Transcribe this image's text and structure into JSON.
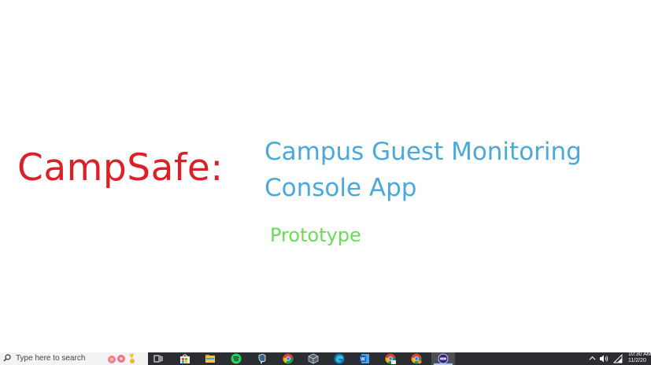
{
  "slide": {
    "title": "CampSafe:",
    "subtitle_line1": "Campus Guest Monitoring",
    "subtitle_line2": "Console App",
    "tagline": "Prototype"
  },
  "taskbar": {
    "search_placeholder": "Type here to search",
    "clock_time": "10:30 AM",
    "clock_date": "11/2/20"
  },
  "colors": {
    "title": "#dd1f26",
    "subtitle": "#4aa8dc",
    "tagline": "#69dd55",
    "taskbar_bg": "#2b2d31"
  }
}
